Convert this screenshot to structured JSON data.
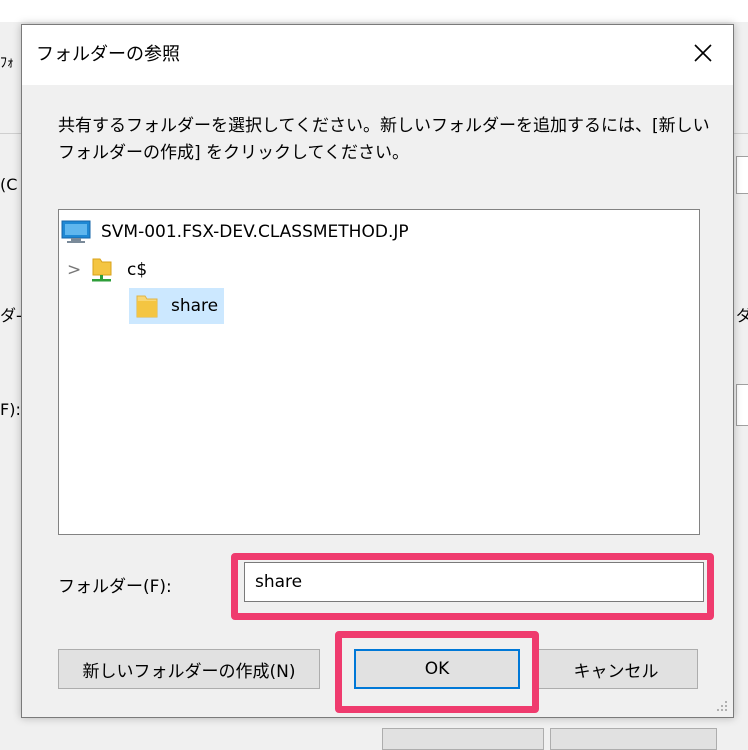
{
  "background": {
    "fragments": [
      "ﾌｫ",
      "(C",
      "ダ-",
      "ダ",
      "F):"
    ]
  },
  "dialog": {
    "title": "フォルダーの参照",
    "close_label": "✕",
    "description": "共有するフォルダーを選択してください。新しいフォルダーを追加するには、[新しいフォルダーの作成] をクリックしてください。",
    "tree": [
      {
        "label": "SVM-001.FSX-DEV.CLASSMETHOD.JP",
        "icon": "computer-icon",
        "level": 0
      },
      {
        "label": "c$",
        "icon": "network-share-icon",
        "level": 1,
        "expander": ">"
      },
      {
        "label": "share",
        "icon": "folder-icon",
        "level": 2,
        "selected": true
      }
    ],
    "folder_label": "フォルダー(F):",
    "folder_value": "share",
    "buttons": {
      "new_folder": "新しいフォルダーの作成(N)",
      "ok": "OK",
      "cancel": "キャンセル"
    }
  },
  "colors": {
    "highlight": "#ef3b6e",
    "selection": "#cce8ff",
    "focus": "#0078d7"
  }
}
